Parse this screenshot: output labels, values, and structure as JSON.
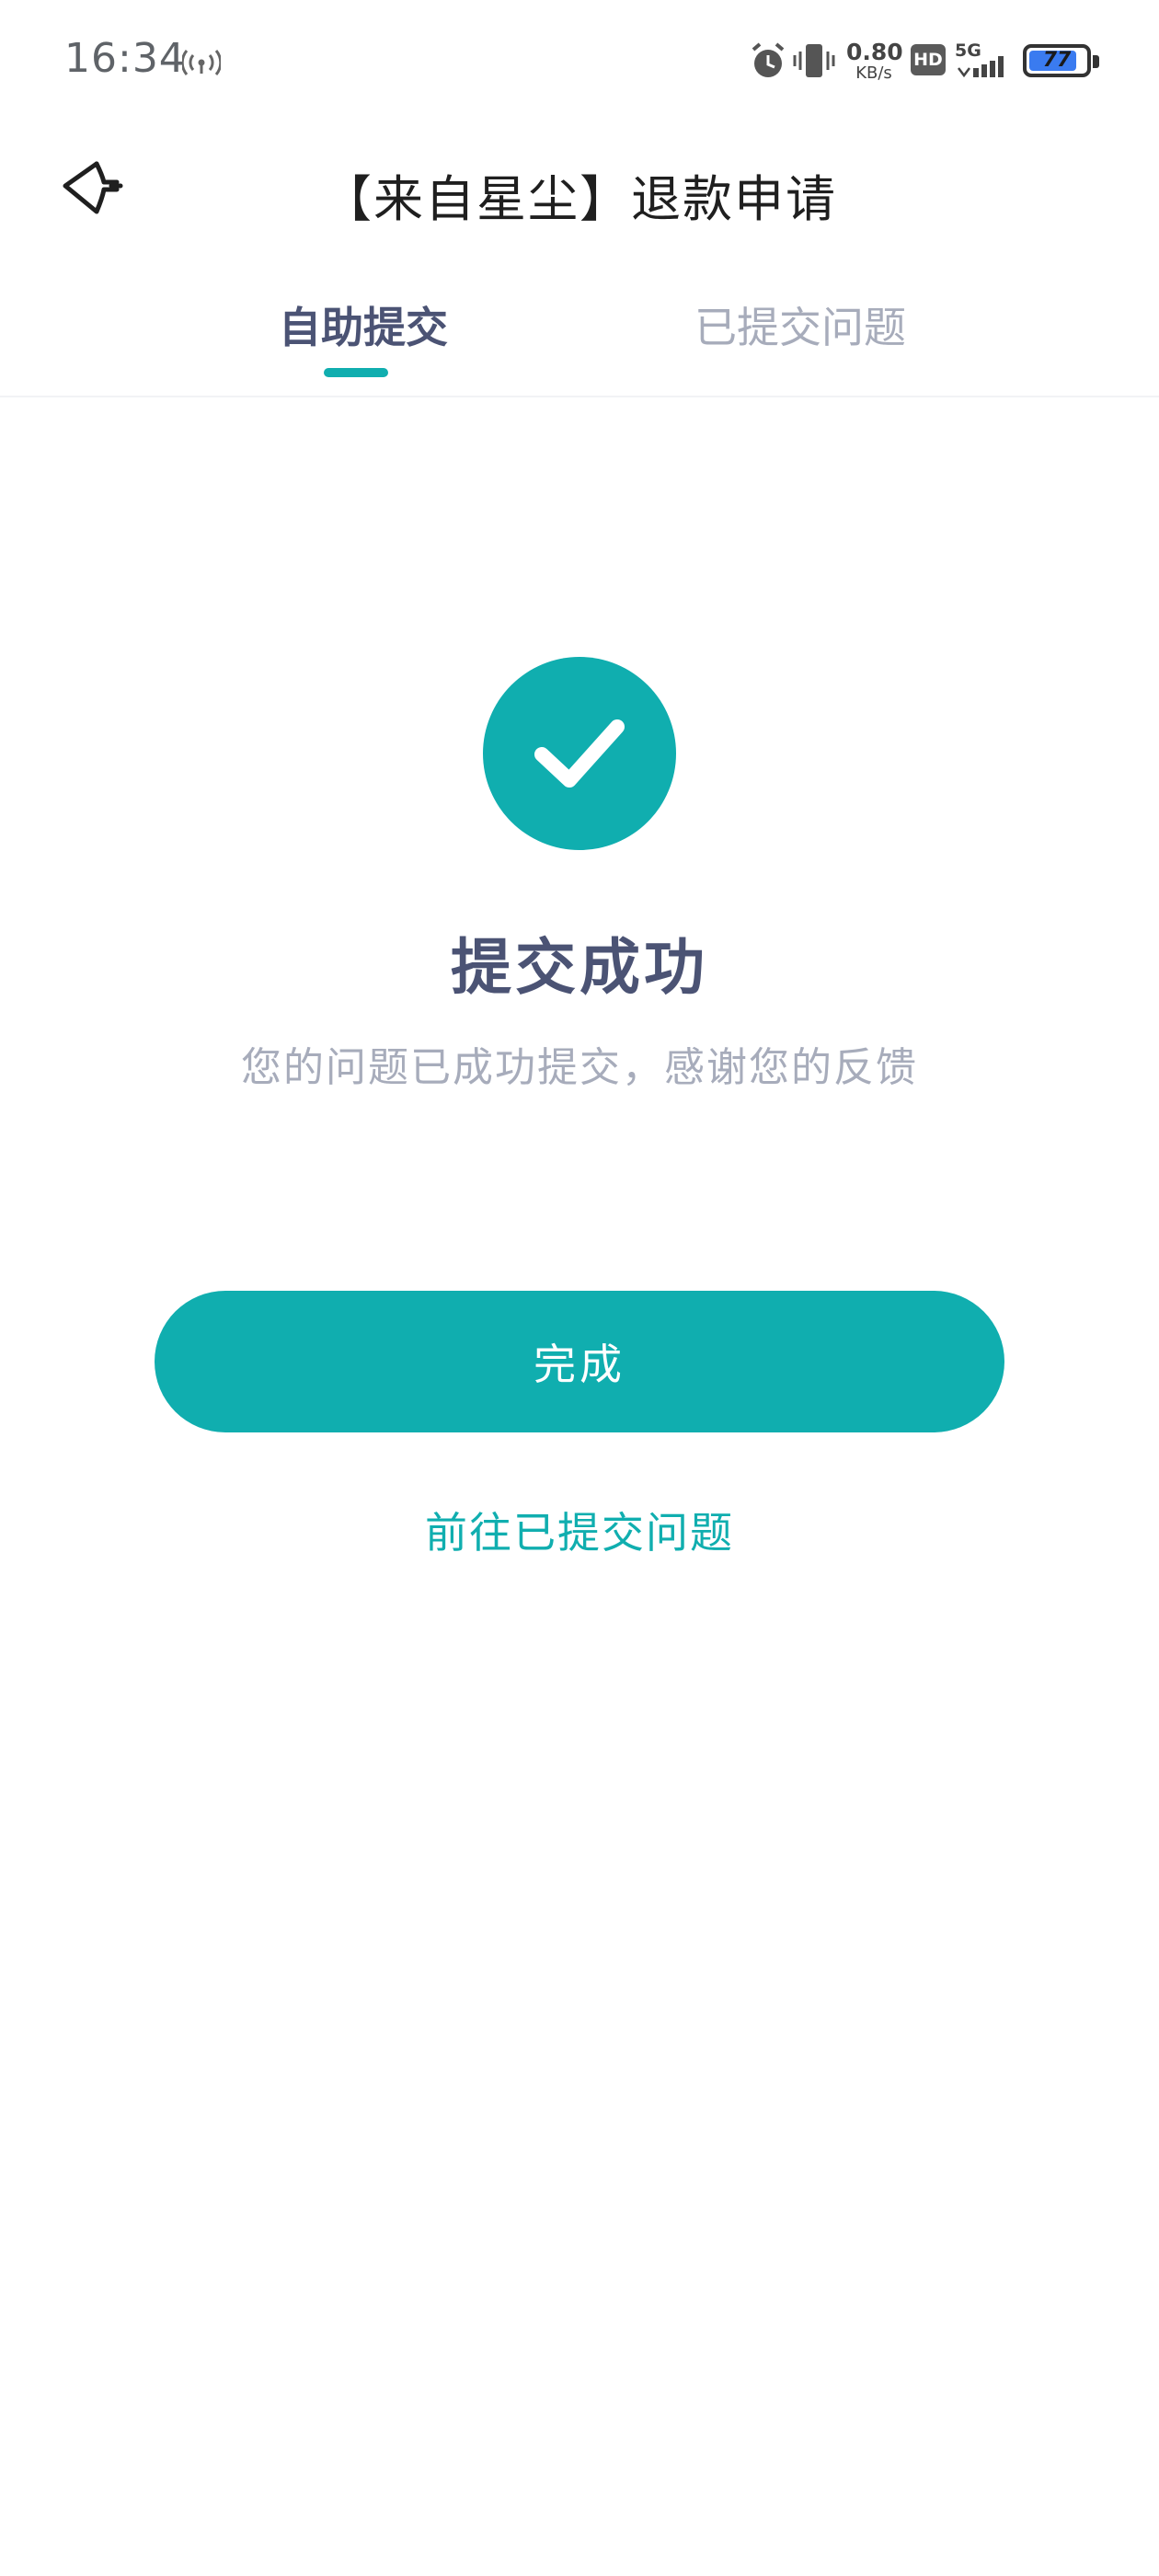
{
  "status_bar": {
    "time": "16:34",
    "network_speed_value": "0.80",
    "network_speed_unit": "KB/s",
    "hd_label": "HD",
    "signal_label": "5G",
    "battery_level": "77",
    "icons": [
      "hotspot-icon",
      "alarm-icon",
      "vibrate-icon",
      "signal-icon",
      "battery-icon"
    ]
  },
  "header": {
    "back_icon": "back-arrow-icon",
    "title": "【来自星尘】退款申请"
  },
  "tabs": [
    {
      "label": "自助提交",
      "active": true
    },
    {
      "label": "已提交问题",
      "active": false
    }
  ],
  "success": {
    "icon": "check-circle-icon",
    "title": "提交成功",
    "subtitle": "您的问题已成功提交，感谢您的反馈"
  },
  "actions": {
    "done_label": "完成",
    "goto_label": "前往已提交问题"
  },
  "colors": {
    "accent": "#10aeaf",
    "primary_text": "#4b5374",
    "secondary_text": "#a7acbb",
    "title_text": "#1f1f1f",
    "background": "#ffffff"
  }
}
